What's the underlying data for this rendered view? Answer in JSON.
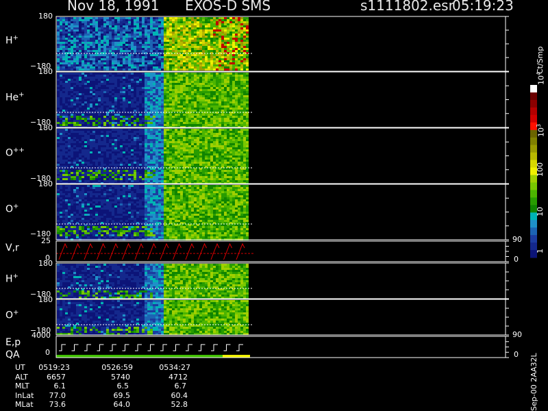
{
  "header": {
    "date": "Nov 18, 1991",
    "instrument": "EXOS-D SMS",
    "file": "s1111802.esr",
    "time": "05:19:23"
  },
  "colorbar": {
    "title": "Ct/Smp",
    "labels": [
      "10",
      "10",
      "100",
      "10",
      "10",
      "1"
    ],
    "exponents": [
      "4",
      "3"
    ],
    "colors": [
      "#ffffff",
      "#6b0000",
      "#8b0000",
      "#b40000",
      "#d00000",
      "#ff1000",
      "#6b6400",
      "#808000",
      "#9a9a00",
      "#b8b800",
      "#d8d800",
      "#f0f000",
      "#a0d000",
      "#78c800",
      "#4cb400",
      "#289c00",
      "#108400",
      "#00b4b4",
      "#1e90c8",
      "#1c64b4",
      "#1c3ca0",
      "#14288c",
      "#0c1478"
    ]
  },
  "panels": [
    {
      "label": "H",
      "sup": "+",
      "top": "180",
      "bottom": "−180"
    },
    {
      "label": "He",
      "sup": "+",
      "top": "180",
      "bottom": "−180"
    },
    {
      "label": "O",
      "sup": "++",
      "top": "180",
      "bottom": "−180"
    },
    {
      "label": "O",
      "sup": "+",
      "top": "180",
      "bottom": "−180"
    },
    {
      "label": "V,r",
      "sup": "",
      "top": "25",
      "bottom": "0",
      "right_top": "90",
      "right_bottom": "0"
    },
    {
      "label": "H",
      "sup": "+",
      "top": "180",
      "bottom": "−180"
    },
    {
      "label": "O",
      "sup": "+",
      "top": "180",
      "bottom": "−180"
    },
    {
      "label": "E,p",
      "sup": "",
      "label2": "QA",
      "top": "4000",
      "bottom": "0",
      "right_top": "90",
      "right_bottom": "0"
    }
  ],
  "footer": {
    "rows": [
      {
        "key": "UT",
        "values": [
          "0519:23",
          "0526:59",
          "0534:27"
        ]
      },
      {
        "key": "ALT",
        "values": [
          "6657",
          "5740",
          "4712"
        ]
      },
      {
        "key": "MLT",
        "values": [
          "6.1",
          "6.5",
          "6.7"
        ]
      },
      {
        "key": "InLat",
        "values": [
          "77.0",
          "69.5",
          "60.4"
        ]
      },
      {
        "key": "MLat",
        "values": [
          "73.6",
          "64.0",
          "52.8"
        ]
      }
    ],
    "side_note": "Sep-00 2AA32L"
  },
  "chart_data": {
    "type": "heatmap",
    "title": "Nov 18, 1991   EXOS-D SMS",
    "time_labels": [
      "0519:23",
      "0526:59",
      "0534:27"
    ],
    "series": [
      {
        "name": "H+",
        "yrange": [
          -180,
          180
        ]
      },
      {
        "name": "He+",
        "yrange": [
          -180,
          180
        ]
      },
      {
        "name": "O++",
        "yrange": [
          -180,
          180
        ]
      },
      {
        "name": "O+",
        "yrange": [
          -180,
          180
        ]
      },
      {
        "name": "V,r",
        "yrange": [
          0,
          25
        ],
        "right_axis": [
          0,
          90
        ]
      },
      {
        "name": "H+",
        "yrange": [
          -180,
          180
        ]
      },
      {
        "name": "O+",
        "yrange": [
          -180,
          180
        ]
      },
      {
        "name": "E,p",
        "yrange": [
          0,
          4000
        ],
        "right_axis": [
          0,
          90
        ]
      }
    ],
    "colorbar_unit": "Ct/Smp",
    "colorbar_range": [
      1,
      10000
    ],
    "colorbar_scale": "log"
  }
}
